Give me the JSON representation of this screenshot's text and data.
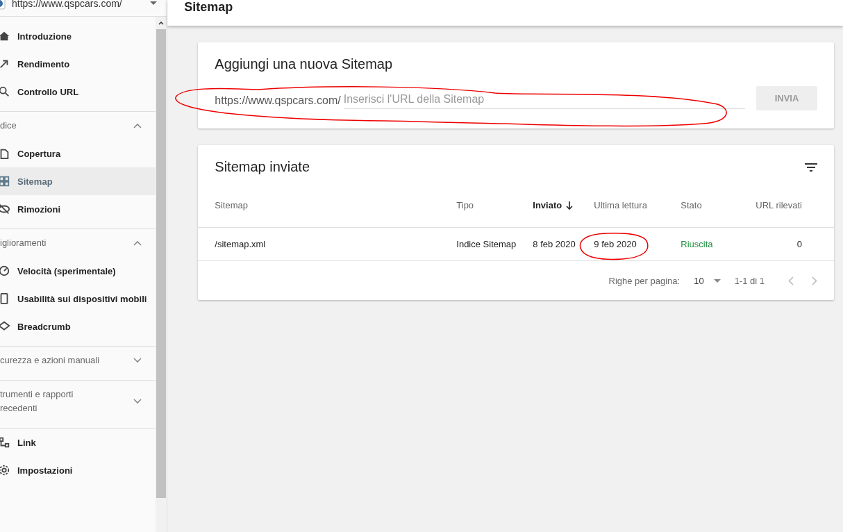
{
  "property": {
    "url": "https://www.qspcars.com/"
  },
  "sidebar": {
    "sections": [
      {
        "items": [
          {
            "label": "Introduzione",
            "selected": false
          },
          {
            "label": "Rendimento",
            "selected": false
          },
          {
            "label": "Controllo URL",
            "selected": false
          }
        ]
      },
      {
        "header": "dice",
        "expanded": true,
        "items": [
          {
            "label": "Copertura",
            "selected": false
          },
          {
            "label": "Sitemap",
            "selected": true
          },
          {
            "label": "Rimozioni",
            "selected": false
          }
        ]
      },
      {
        "header": "iglioramenti",
        "expanded": true,
        "items": [
          {
            "label": "Velocità (sperimentale)",
            "selected": false
          },
          {
            "label": "Usabilità sui dispositivi mobili",
            "selected": false
          },
          {
            "label": "Breadcrumb",
            "selected": false
          }
        ]
      },
      {
        "header": "curezza e azioni manuali",
        "expanded": false
      },
      {
        "header": "trumenti e rapporti\nrecedenti",
        "expanded": false
      },
      {
        "items": [
          {
            "label": "Link",
            "selected": false
          },
          {
            "label": "Impostazioni",
            "selected": false
          }
        ]
      }
    ]
  },
  "page": {
    "title": "Sitemap"
  },
  "add_card": {
    "title": "Aggiungi una nuova Sitemap",
    "prefix": "https://www.qspcars.com/",
    "placeholder": "Inserisci l'URL della Sitemap",
    "button": "INVIA",
    "button_disabled": true
  },
  "table": {
    "title": "Sitemap inviate",
    "columns": [
      {
        "label": "Sitemap",
        "sorted": false
      },
      {
        "label": "Tipo",
        "sorted": false
      },
      {
        "label": "Inviato",
        "sorted": true
      },
      {
        "label": "Ultima lettura",
        "sorted": false
      },
      {
        "label": "Stato",
        "sorted": false
      },
      {
        "label": "URL rilevati",
        "sorted": false
      }
    ],
    "rows": [
      {
        "cells": [
          "/sitemap.xml",
          "Indice Sitemap",
          "8 feb 2020",
          "9 feb 2020",
          "Riuscita",
          "0"
        ],
        "color": "#1e8e3e"
      }
    ],
    "footer": {
      "rows_per_page_label": "Righe per pagina:",
      "rows_per_page": "10",
      "range": "1-1 di 1",
      "prev_disabled": true,
      "next_disabled": true
    }
  }
}
